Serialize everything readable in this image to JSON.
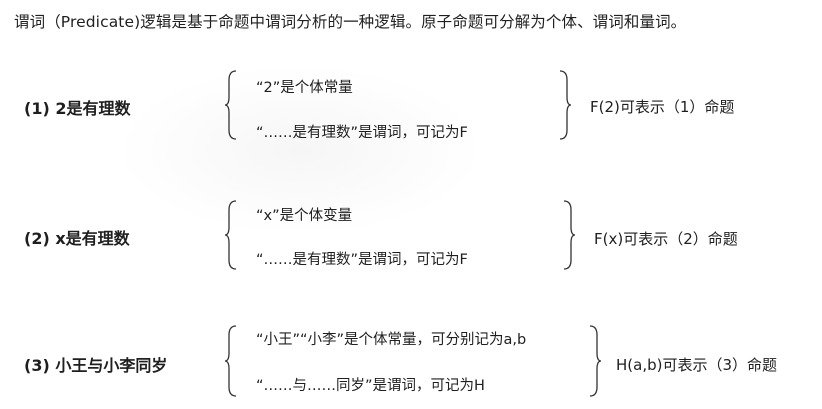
{
  "intro": "谓词（Predicate)逻辑是基于命题中谓词分析的一种逻辑。原子命题可分解为个体、谓词和量词。",
  "examples": [
    {
      "label": "(1)  2是有理数",
      "line1": "“2”是个体常量",
      "line2": "“……是有理数”是谓词，可记为F",
      "result": "F(2)可表示（1）命题"
    },
    {
      "label": "(2)  x是有理数",
      "line1": "“x”是个体变量",
      "line2": "“……是有理数”是谓词，可记为F",
      "result": "F(x)可表示（2）命题"
    },
    {
      "label": "(3)  小王与小李同岁",
      "line1": "“小王”“小李”是个体常量，可分别记为a,b",
      "line2": "“……与……同岁”是谓词，可记为H",
      "result": "H(a,b)可表示（3）命题"
    }
  ]
}
